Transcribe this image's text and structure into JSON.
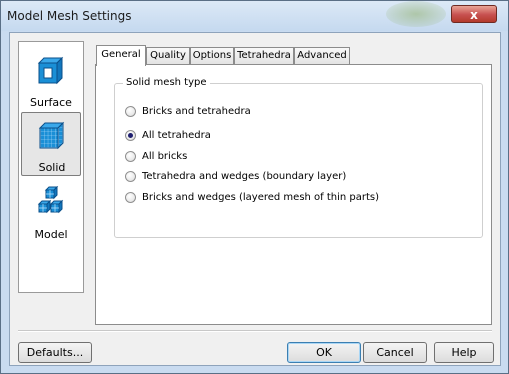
{
  "window": {
    "title": "Model Mesh Settings",
    "close_glyph": "x"
  },
  "sidebar": {
    "items": [
      {
        "label": "Surface",
        "icon": "surface-mesh-icon",
        "selected": false
      },
      {
        "label": "Solid",
        "icon": "solid-mesh-icon",
        "selected": true
      },
      {
        "label": "Model",
        "icon": "model-mesh-icon",
        "selected": false
      }
    ]
  },
  "tabs": [
    {
      "label": "General",
      "selected": true
    },
    {
      "label": "Quality",
      "selected": false
    },
    {
      "label": "Options",
      "selected": false
    },
    {
      "label": "Tetrahedra",
      "selected": false
    },
    {
      "label": "Advanced",
      "selected": false
    }
  ],
  "general": {
    "group_title": "Solid mesh type",
    "options": [
      {
        "label": "Bricks and tetrahedra",
        "checked": false
      },
      {
        "label": "All tetrahedra",
        "checked": true
      },
      {
        "label": "All bricks",
        "checked": false
      },
      {
        "label": "Tetrahedra and wedges (boundary layer)",
        "checked": false
      },
      {
        "label": "Bricks and wedges (layered mesh of thin parts)",
        "checked": false
      }
    ]
  },
  "buttons": {
    "defaults": "Defaults...",
    "ok": "OK",
    "cancel": "Cancel",
    "help": "Help"
  },
  "colors": {
    "mesh_icon": "#1a8fd6",
    "mesh_icon_dark": "#0a4f8a"
  }
}
